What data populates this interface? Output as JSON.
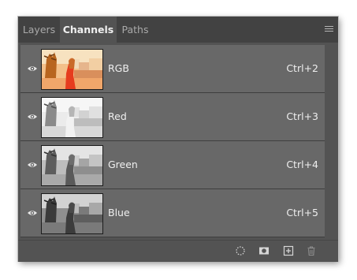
{
  "tabs": [
    {
      "label": "Layers",
      "active": false
    },
    {
      "label": "Channels",
      "active": true
    },
    {
      "label": "Paths",
      "active": false
    }
  ],
  "channels": [
    {
      "name": "RGB",
      "shortcut": "Ctrl+2",
      "visible": true,
      "selected": true,
      "thumbnail": "color"
    },
    {
      "name": "Red",
      "shortcut": "Ctrl+3",
      "visible": true,
      "selected": true,
      "thumbnail": "light-grayscale"
    },
    {
      "name": "Green",
      "shortcut": "Ctrl+4",
      "visible": true,
      "selected": true,
      "thumbnail": "mid-grayscale"
    },
    {
      "name": "Blue",
      "shortcut": "Ctrl+5",
      "visible": true,
      "selected": true,
      "thumbnail": "dark-grayscale"
    }
  ],
  "icons": {
    "panel_menu": "panel-menu-icon",
    "eye": "eye-icon",
    "load_selection": "load-channel-as-selection-icon",
    "save_selection": "save-selection-as-channel-icon",
    "new_channel": "new-channel-icon",
    "delete": "trash-icon"
  },
  "colors": {
    "panel_bg": "#535353",
    "tab_bar_bg": "#424242",
    "selected_row_bg": "#686868",
    "text": "#efefef"
  }
}
